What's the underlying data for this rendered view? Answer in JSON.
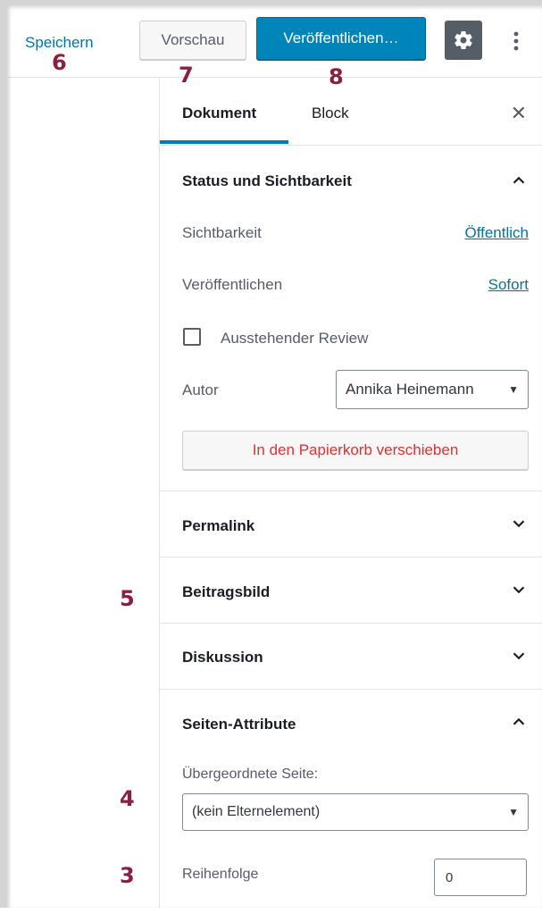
{
  "toolbar": {
    "save_label": "Speichern",
    "preview_label": "Vorschau",
    "publish_label": "Veröffentlichen…",
    "settings_icon": "gear-icon",
    "more_icon": "vertical-ellipsis-icon"
  },
  "annotations": {
    "a6": "6",
    "a7": "7",
    "a8": "8",
    "a5": "5",
    "a4": "4",
    "a3": "3"
  },
  "sidebar": {
    "tabs": [
      {
        "label": "Dokument",
        "active": true
      },
      {
        "label": "Block",
        "active": false
      }
    ],
    "close_icon": "close-icon",
    "status": {
      "title": "Status und Sichtbarkeit",
      "expanded": true,
      "visibility_label": "Sichtbarkeit",
      "visibility_value": "Öffentlich",
      "publish_label": "Veröffentlichen",
      "publish_value": "Sofort",
      "pending_review_label": "Ausstehender Review",
      "pending_review_checked": false,
      "author_label": "Autor",
      "author_value": "Annika Heinemann",
      "trash_label": "In den Papierkorb verschieben"
    },
    "permalink": {
      "title": "Permalink",
      "expanded": false
    },
    "featured_image": {
      "title": "Beitragsbild",
      "expanded": false
    },
    "discussion": {
      "title": "Diskussion",
      "expanded": false
    },
    "page_attributes": {
      "title": "Seiten-Attribute",
      "expanded": true,
      "parent_label": "Übergeordnete Seite:",
      "parent_value": "(kein Elternelement)",
      "order_label": "Reihenfolge",
      "order_value": "0"
    }
  },
  "colors": {
    "accent": "#0085ba",
    "link": "#0073aa",
    "danger": "#dc3232",
    "annotation": "#8b1f3f"
  }
}
